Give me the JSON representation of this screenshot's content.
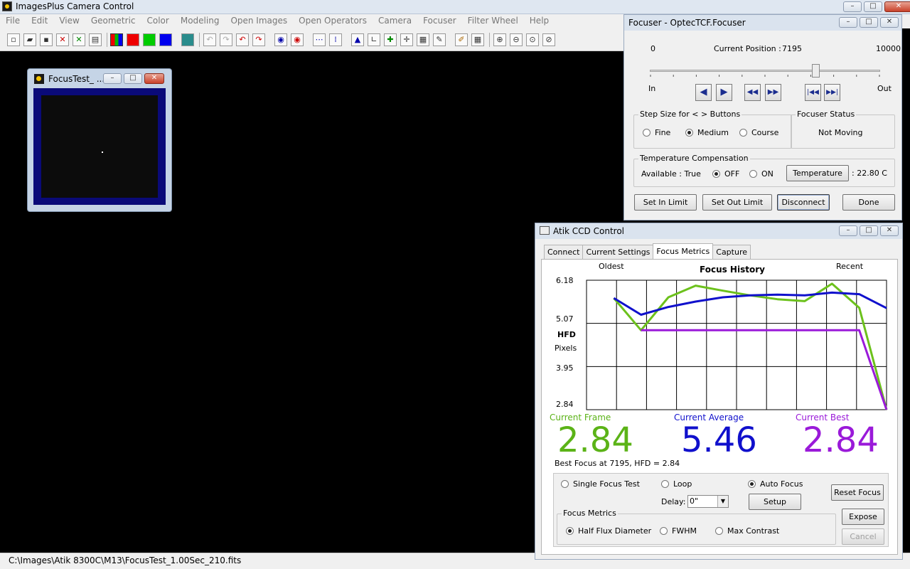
{
  "main_window": {
    "title": "ImagesPlus Camera Control",
    "menu": [
      "File",
      "Edit",
      "View",
      "Geometric",
      "Color",
      "Modeling",
      "Open Images",
      "Open Operators",
      "Camera",
      "Focuser",
      "Filter Wheel",
      "Help"
    ]
  },
  "status_bar": {
    "path": "C:\\Images\\Atik 8300C\\M13\\FocusTest_1.00Sec_210.fits"
  },
  "image_window": {
    "title": "FocusTest_ ..."
  },
  "focuser": {
    "title": "Focuser - OptecTCF.Focuser",
    "min": "0",
    "max": "10000",
    "current_position_label": "Current Position :",
    "current_position": "7195",
    "position_value": 7195,
    "in_label": "In",
    "out_label": "Out",
    "step_group_title": "Step Size for < > Buttons",
    "step_options": [
      "Fine",
      "Medium",
      "Course"
    ],
    "step_selected": "Medium",
    "status_group_title": "Focuser Status",
    "status": "Not Moving",
    "temp_group_title": "Temperature Compensation",
    "available": "Available : True",
    "temp_off": "OFF",
    "temp_on": "ON",
    "temp_button": "Temperature",
    "temperature": ": 22.80 C",
    "buttons": {
      "set_in": "Set In Limit",
      "set_out": "Set Out Limit",
      "disconnect": "Disconnect",
      "done": "Done"
    }
  },
  "atik": {
    "title": "Atik CCD Control",
    "tabs": [
      "Connect",
      "Current Settings",
      "Focus Metrics",
      "Capture"
    ],
    "active_tab": "Focus Metrics",
    "oldest_label": "Oldest",
    "recent_label": "Recent",
    "current_frame_label": "Current Frame",
    "current_frame": "2.84",
    "current_average_label": "Current Average",
    "current_average": "5.46",
    "current_best_label": "Current Best",
    "current_best": "2.84",
    "best_focus_text": "Best Focus at 7195, HFD =  2.84",
    "modes": {
      "single": "Single Focus Test",
      "loop": "Loop",
      "auto": "Auto Focus"
    },
    "delay_label": "Delay:",
    "delay_value": "0\"",
    "setup_button": "Setup",
    "reset_focus_button": "Reset Focus",
    "expose_button": "Expose",
    "cancel_button": "Cancel",
    "metrics_group_title": "Focus Metrics",
    "metrics": {
      "hfd": "Half Flux Diameter",
      "fwhm": "FWHM",
      "max_contrast": "Max Contrast"
    }
  },
  "chart_data": {
    "type": "line",
    "title": "Focus History",
    "ylabel_line1": "HFD",
    "ylabel_line2": "Pixels",
    "yticks": [
      "6.18",
      "5.07",
      "3.95",
      "2.84"
    ],
    "ylim": [
      2.84,
      6.18
    ],
    "x": [
      1,
      2,
      3,
      4,
      5,
      6,
      7,
      8,
      9,
      10,
      11
    ],
    "xlim": [
      0,
      11
    ],
    "grid": true,
    "series": [
      {
        "color": "#6cc11c",
        "values": [
          5.72,
          4.89,
          5.74,
          6.04,
          5.91,
          5.79,
          5.69,
          5.64,
          6.09,
          5.47,
          2.84
        ]
      },
      {
        "color": "#1010cc",
        "values": [
          5.72,
          5.29,
          5.49,
          5.63,
          5.74,
          5.79,
          5.81,
          5.79,
          5.86,
          5.82,
          5.46
        ]
      },
      {
        "color": "#9a1ad9",
        "values": [
          null,
          4.89,
          4.89,
          4.89,
          4.89,
          4.89,
          4.89,
          4.89,
          4.89,
          4.89,
          2.84
        ]
      }
    ]
  }
}
